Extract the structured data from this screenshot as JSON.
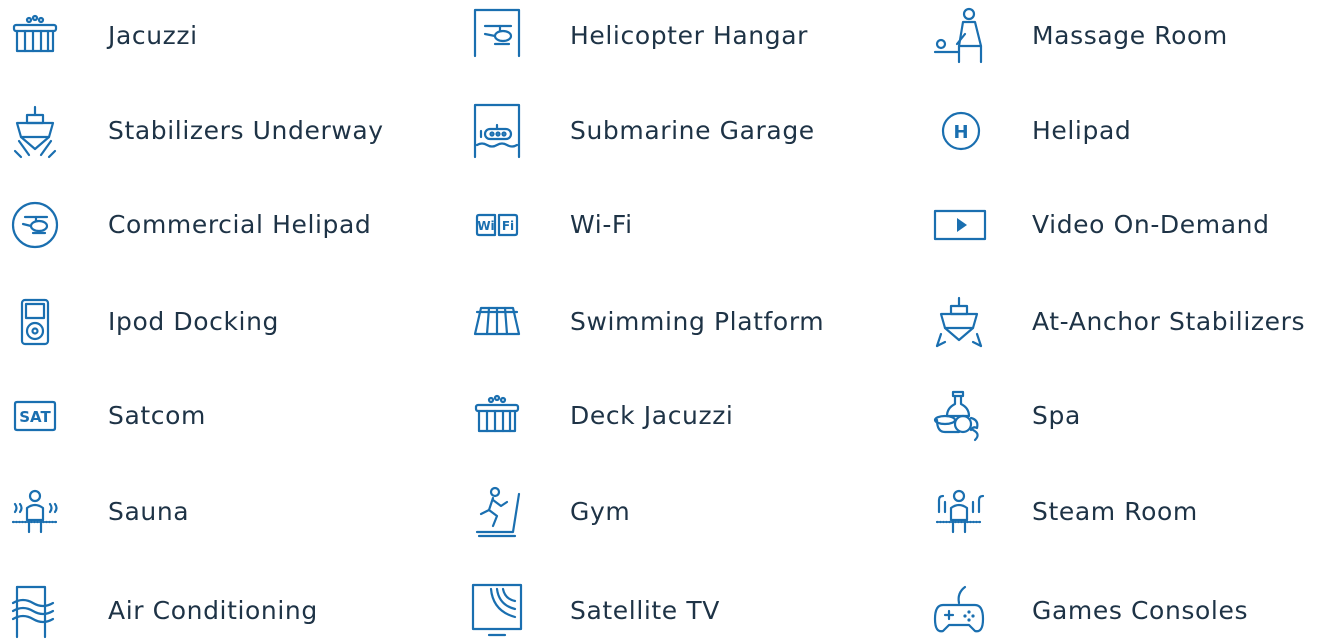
{
  "amenities": {
    "col0": [
      {
        "label": "Jacuzzi",
        "icon": "jacuzzi-icon"
      },
      {
        "label": "Stabilizers Underway",
        "icon": "stabilizers-underway-icon"
      },
      {
        "label": "Commercial Helipad",
        "icon": "commercial-helipad-icon"
      },
      {
        "label": "Ipod Docking",
        "icon": "ipod-icon"
      },
      {
        "label": "Satcom",
        "icon": "satcom-icon",
        "badge": "SAT"
      },
      {
        "label": "Sauna",
        "icon": "sauna-icon"
      },
      {
        "label": "Air Conditioning",
        "icon": "air-conditioning-icon"
      }
    ],
    "col1": [
      {
        "label": "Helicopter Hangar",
        "icon": "helicopter-hangar-icon"
      },
      {
        "label": "Submarine Garage",
        "icon": "submarine-icon"
      },
      {
        "label": "Wi-Fi",
        "icon": "wifi-icon",
        "badge_left": "Wi",
        "badge_right": "Fi"
      },
      {
        "label": "Swimming Platform",
        "icon": "swimming-platform-icon"
      },
      {
        "label": "Deck Jacuzzi",
        "icon": "deck-jacuzzi-icon"
      },
      {
        "label": "Gym",
        "icon": "gym-icon"
      },
      {
        "label": "Satellite TV",
        "icon": "satellite-tv-icon"
      }
    ],
    "col2": [
      {
        "label": "Massage Room",
        "icon": "massage-icon"
      },
      {
        "label": "Helipad",
        "icon": "helipad-icon",
        "badge": "H"
      },
      {
        "label": "Video On-Demand",
        "icon": "video-on-demand-icon"
      },
      {
        "label": "At-Anchor Stabilizers",
        "icon": "at-anchor-stabilizers-icon"
      },
      {
        "label": "Spa",
        "icon": "spa-icon"
      },
      {
        "label": "Steam Room",
        "icon": "steam-room-icon"
      },
      {
        "label": "Games Consoles",
        "icon": "gamepad-icon"
      }
    ]
  },
  "colors": {
    "icon": "#1a6fb0",
    "text": "#1e3346",
    "background": "#ffffff"
  }
}
